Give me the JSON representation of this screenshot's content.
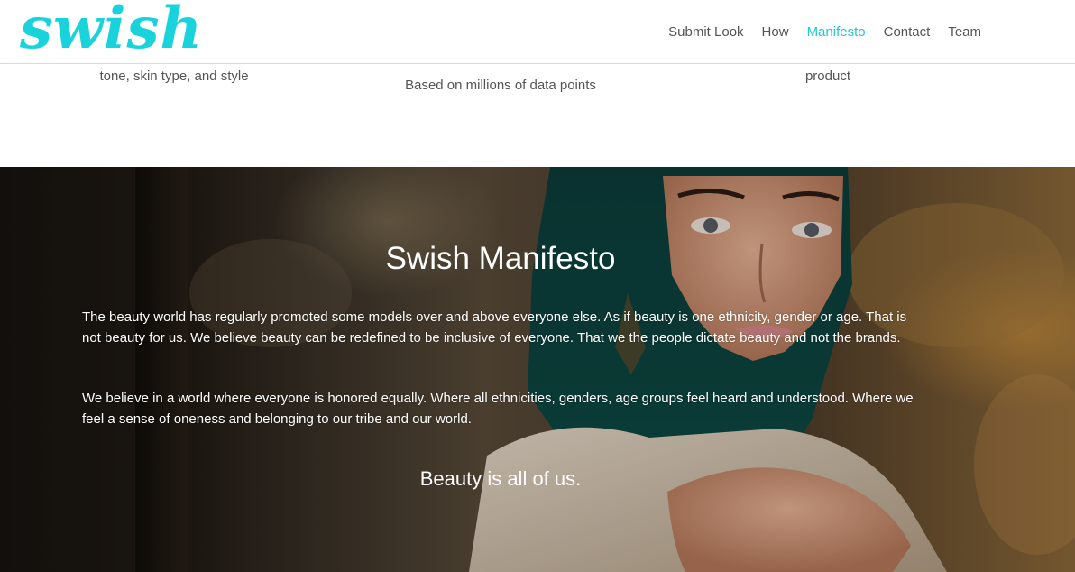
{
  "header": {
    "logo": "swish",
    "nav": [
      {
        "label": "Submit Look",
        "active": false
      },
      {
        "label": "How",
        "active": false
      },
      {
        "label": "Manifesto",
        "active": true
      },
      {
        "label": "Contact",
        "active": false
      },
      {
        "label": "Team",
        "active": false
      }
    ]
  },
  "features": {
    "captions": [
      "tone, skin type, and style",
      "Based on millions of data points",
      "product"
    ]
  },
  "manifesto": {
    "title": "Swish Manifesto",
    "paragraphs": [
      "The beauty world has regularly promoted some models over and above everyone else. As if beauty is one ethnicity, gender or age. That is not beauty for us. We believe beauty can be redefined to be inclusive of everyone. That we the people dictate beauty and not the brands.",
      "We believe in a world where everyone is honored equally. Where all ethnicities, genders, age groups feel heard and understood. Where we feel a sense of oneness and belonging to our tribe and our world."
    ],
    "tagline": "Beauty is all of us."
  },
  "colors": {
    "brand": "#19d3dc",
    "nav_active": "#1fc8d2",
    "nav_text": "#555555"
  }
}
